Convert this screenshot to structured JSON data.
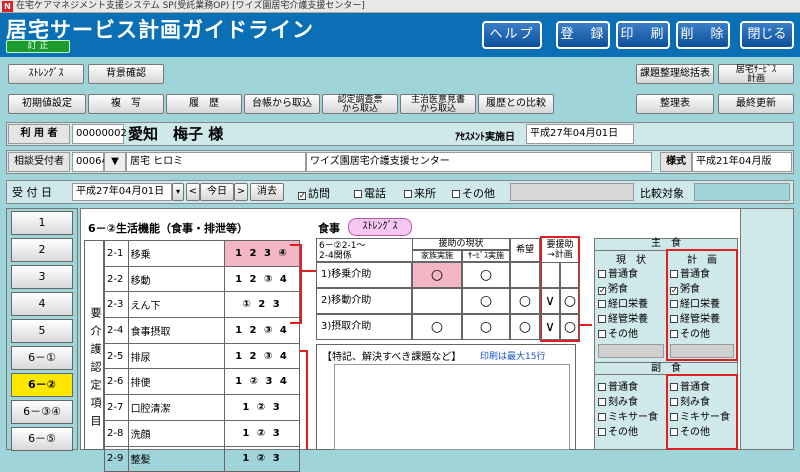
{
  "window": {
    "title": "在宅ケアマネジメント支援システム SP(受託業務OP)  [ワイズ園居宅介護支援センター]"
  },
  "header": {
    "title": "居宅サービス計画ガイドライン",
    "mode": "訂  正",
    "buttons": [
      "ヘルプ",
      "登　録",
      "印　刷",
      "削　除",
      "閉じる"
    ]
  },
  "toolbar": {
    "row1": [
      "ｽﾄﾚﾝｸﾞｽ",
      "背景確認"
    ],
    "row1_right": [
      "課題整理総括表",
      "居宅ｻｰﾋﾞｽ\n計画"
    ],
    "row2": [
      "初期値設定",
      "複　写",
      "履　歴",
      "台帳から取込",
      "認定調査票\nから取込",
      "主治医意見書\nから取込",
      "履歴との比較"
    ],
    "row2_right": [
      "整理表",
      "最終更新"
    ]
  },
  "user": {
    "label": "利 用 者",
    "id": "00000002",
    "name": "愛知　梅子 様",
    "assess_label": "ｱｾｽﾒﾝﾄ実施日",
    "assess_date": "平成27年04月01日"
  },
  "consult": {
    "label": "相談受付者",
    "code": "00064",
    "staff": "居宅 ヒロミ",
    "office": "ワイズ園居宅介護支援センター",
    "style_label": "様式",
    "style_value": "平成21年04月版"
  },
  "reception": {
    "label": "受 付 日",
    "date": "平成27年04月01日",
    "prev": "<",
    "today": "今日",
    "next": ">",
    "clear": "消去",
    "methods": [
      {
        "label": "訪問",
        "checked": true
      },
      {
        "label": "電話",
        "checked": false
      },
      {
        "label": "来所",
        "checked": false
      },
      {
        "label": "その他",
        "checked": false
      }
    ],
    "compare_label": "比較対象"
  },
  "sidebar": [
    "1",
    "2",
    "3",
    "4",
    "5",
    "6－①",
    "6－②",
    "6－③④",
    "6－⑤"
  ],
  "section": {
    "title": "6－②生活機能（食事・排泄等）",
    "vertical": "要介護認定項目",
    "items": [
      {
        "code": "2-1",
        "name": "移乗",
        "levels": "1 2 3 ④"
      },
      {
        "code": "2-2",
        "name": "移動",
        "levels": "1 2 ③ 4"
      },
      {
        "code": "2-3",
        "name": "えん下",
        "levels": "① 2 3"
      },
      {
        "code": "2-4",
        "name": "食事摂取",
        "levels": "1 2 ③ 4"
      },
      {
        "code": "2-5",
        "name": "排尿",
        "levels": "1 2 ③ 4"
      },
      {
        "code": "2-6",
        "name": "排便",
        "levels": "1 ② 3 4"
      },
      {
        "code": "2-7",
        "name": "口腔清潔",
        "levels": "1 ② 3"
      },
      {
        "code": "2-8",
        "name": "洗顔",
        "levels": "1 ② 3"
      },
      {
        "code": "2-9",
        "name": "整髪",
        "levels": "1 ② 3"
      }
    ]
  },
  "meal": {
    "label": "食事",
    "strength": "ｽﾄﾚﾝｸﾞｽ",
    "head1": "6－②2-1～\n2-4関係",
    "head2": "援助の現状",
    "head2a": "家族実施",
    "head2b": "ｻｰﾋﾞｽ実施",
    "head3": "希望",
    "head4": "要援助\n→計画",
    "rows": [
      {
        "label": "1)移乗介助",
        "family": "○",
        "service": "○",
        "wish": "",
        "need": "",
        "plan": ""
      },
      {
        "label": "2)移動介助",
        "family": "",
        "service": "○",
        "wish": "○",
        "need": "∨",
        "plan": "○"
      },
      {
        "label": "3)摂取介助",
        "family": "○",
        "service": "○",
        "wish": "○",
        "need": "∨",
        "plan": "○"
      }
    ],
    "notes_label": "【特記、解決すべき課題など】",
    "notes_hint": "印刷は最大15行"
  },
  "staple": {
    "title": "主　食",
    "col1": "現　状",
    "col2": "計　画",
    "options": [
      "普通食",
      "粥食",
      "経口栄養",
      "経管栄養",
      "その他"
    ],
    "current": [
      false,
      true,
      false,
      false,
      false
    ],
    "plan": [
      false,
      true,
      false,
      false,
      false
    ]
  },
  "side_dish": {
    "title": "副　食",
    "options": [
      "普通食",
      "刻み食",
      "ミキサー食",
      "その他"
    ]
  }
}
